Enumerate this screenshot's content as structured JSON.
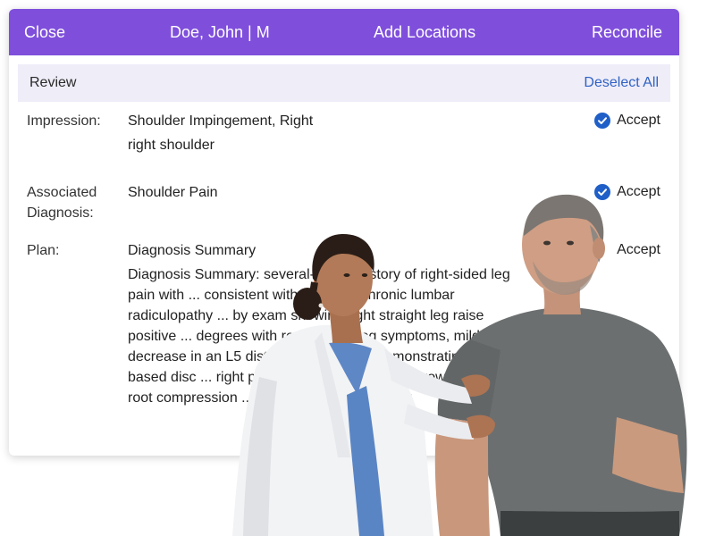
{
  "header": {
    "close_label": "Close",
    "patient": "Doe, John | M",
    "add_locations_label": "Add Locations",
    "reconcile_label": "Reconcile",
    "color": "#7f4fdc"
  },
  "review": {
    "title": "Review",
    "deselect_all_label": "Deselect All"
  },
  "rows": [
    {
      "label": "Impression:",
      "value_line1": "Shoulder Impingement, Right",
      "value_line2": "right shoulder",
      "accept_label": "Accept",
      "accepted": true
    },
    {
      "label": "Associated Diagnosis:",
      "value_line1": "Shoulder Pain",
      "accept_label": "Accept",
      "accepted": true
    },
    {
      "label": "Plan:",
      "summary_title": "Diagnosis Summary",
      "summary_text": "Diagnosis Summary: several-month history of right-sided leg pain with ... consistent with acute on chronic lumbar radiculopathy ... by exam showing right straight leg raise positive ... degrees with reproduced leg symptoms, mild sensory decrease in an L5 distribution and MRI demonstrating ... broad-based disc ... right paracentral ... foraminal narrowing ... nerve root compression ... desk ... prolonged sitting",
      "accept_label": "Accept"
    }
  ],
  "photo": {
    "subject": "doctor-examining-patient-shoulder"
  }
}
